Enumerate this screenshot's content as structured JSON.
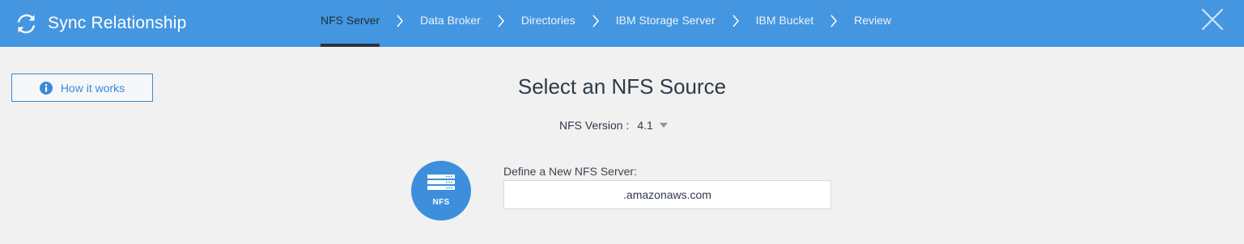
{
  "header": {
    "title": "Sync Relationship",
    "steps": [
      {
        "label": "NFS Server",
        "active": true
      },
      {
        "label": "Data Broker",
        "active": false
      },
      {
        "label": "Directories",
        "active": false
      },
      {
        "label": "IBM Storage Server",
        "active": false
      },
      {
        "label": "IBM Bucket",
        "active": false
      },
      {
        "label": "Review",
        "active": false
      }
    ],
    "icons": {
      "brand": "sync-icon",
      "close": "close-icon",
      "separator": "chevron-right-icon"
    }
  },
  "how_it_works": {
    "label": "How it works",
    "icon": "info-icon"
  },
  "main": {
    "title": "Select an NFS Source",
    "version_label": "NFS Version :",
    "version_value": "4.1",
    "server_badge": "NFS",
    "server_field_label": "Define a New NFS Server:",
    "server_field_value": ".amazonaws.com"
  },
  "colors": {
    "header_bg": "#4596e0",
    "accent": "#3a8ad6",
    "page_bg": "#f1f1f1",
    "active_step_indicator": "#2a3440"
  }
}
